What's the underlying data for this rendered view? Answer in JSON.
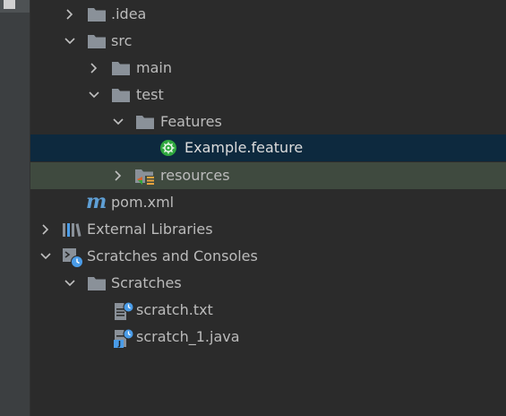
{
  "tree": {
    "idea_label": ".idea",
    "src_label": "src",
    "main_label": "main",
    "test_label": "test",
    "features_label": "Features",
    "example_label": "Example.feature",
    "resources_label": "resources",
    "pom_label": "pom.xml",
    "pom_icon_glyph": "m",
    "external_label": "External Libraries",
    "scratches_consoles_label": "Scratches and Consoles",
    "scratches_label": "Scratches",
    "scratch_txt_label": "scratch.txt",
    "scratch_java_label": "scratch_1.java",
    "java_badge": "J"
  },
  "colors": {
    "background": "#2b2b2b",
    "selected_row": "#0d293e",
    "highlight_row": "#3f4a3f",
    "folder": "#8a9199",
    "cucumber": "#2fa83e",
    "maven": "#5f9fd5",
    "scratch_badge": "#4a9ce8"
  }
}
